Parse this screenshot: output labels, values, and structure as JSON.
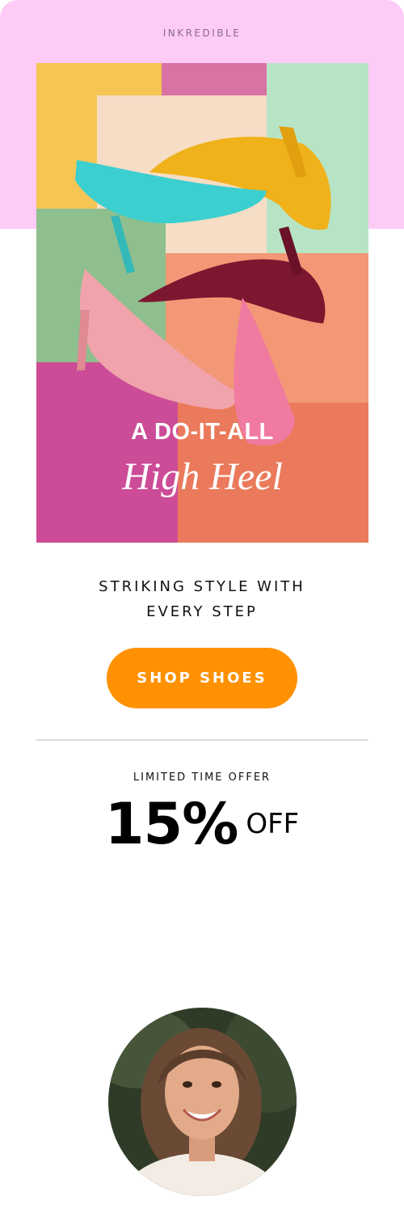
{
  "brand": {
    "name": "INKREDIBLE"
  },
  "hero": {
    "title": "A DO-IT-ALL",
    "script": "High Heel",
    "image": "colorful-high-heels-photo"
  },
  "tagline": {
    "line1": "STRIKING STYLE WITH",
    "line2": "EVERY STEP"
  },
  "cta": {
    "label": "SHOP SHOES"
  },
  "offer": {
    "label": "LIMITED TIME OFFER",
    "percent": "15%",
    "suffix": "OFF"
  },
  "avatar": {
    "image": "smiling-woman-portrait"
  },
  "colors": {
    "band": "#fecbf6",
    "button": "#ff9102",
    "text": "#111111"
  }
}
